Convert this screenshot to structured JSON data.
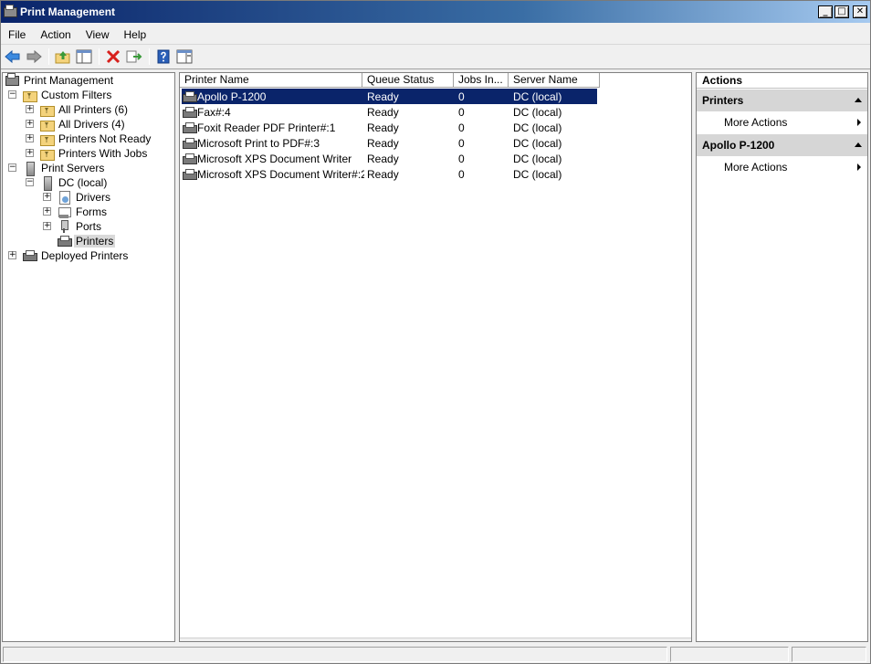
{
  "window": {
    "title": "Print Management"
  },
  "window_buttons": {
    "minimize": "_",
    "maximize": "□",
    "close": "✕"
  },
  "menu": [
    "File",
    "Action",
    "View",
    "Help"
  ],
  "toolbar": [
    "back-icon",
    "forward-icon",
    "up-folder-icon",
    "show-hide-tree-icon",
    "delete-icon",
    "export-list-icon",
    "help-icon",
    "show-hide-action-pane-icon"
  ],
  "tree": {
    "root": "Print Management",
    "custom_filters": "Custom Filters",
    "all_printers": "All Printers (6)",
    "all_drivers": "All Drivers (4)",
    "printers_not_ready": "Printers Not Ready",
    "printers_with_jobs": "Printers With Jobs",
    "print_servers": "Print Servers",
    "dc_local": "DC (local)",
    "drivers": "Drivers",
    "forms": "Forms",
    "ports": "Ports",
    "printers": "Printers",
    "deployed_printers": "Deployed Printers",
    "expander_plus": "+",
    "expander_minus": "−"
  },
  "list": {
    "columns": [
      "Printer Name",
      "Queue Status",
      "Jobs In...",
      "Server Name"
    ],
    "rows": [
      {
        "name": "Apollo P-1200",
        "status": "Ready",
        "jobs": "0",
        "server": "DC (local)",
        "selected": true
      },
      {
        "name": "Fax#:4",
        "status": "Ready",
        "jobs": "0",
        "server": "DC (local)"
      },
      {
        "name": "Foxit Reader PDF Printer#:1",
        "status": "Ready",
        "jobs": "0",
        "server": "DC (local)"
      },
      {
        "name": "Microsoft Print to PDF#:3",
        "status": "Ready",
        "jobs": "0",
        "server": "DC (local)"
      },
      {
        "name": "Microsoft XPS Document Writer",
        "status": "Ready",
        "jobs": "0",
        "server": "DC (local)"
      },
      {
        "name": "Microsoft XPS Document Writer#:2",
        "status": "Ready",
        "jobs": "0",
        "server": "DC (local)"
      }
    ]
  },
  "actions": {
    "title": "Actions",
    "sections": [
      {
        "header": "Printers",
        "item": "More Actions"
      },
      {
        "header": "Apollo P-1200",
        "item": "More Actions"
      }
    ]
  },
  "colors": {
    "selection": "#0a246a",
    "title_bar_start": "#0a246a",
    "section_bg": "#d6d6d6"
  }
}
